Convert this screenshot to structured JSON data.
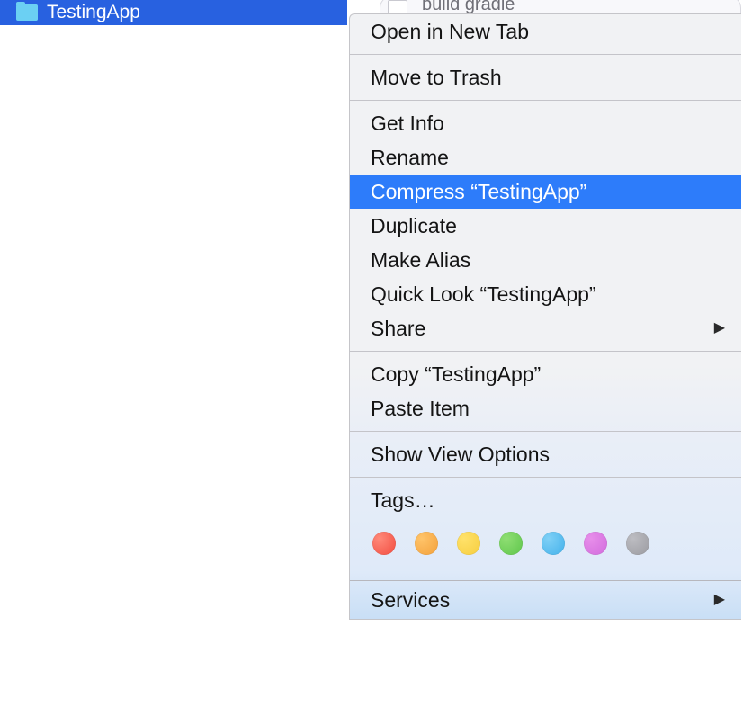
{
  "selected_item": {
    "name": "TestingApp"
  },
  "background_hint_file": "build gradle",
  "menu": {
    "open_in_new_tab": "Open in New Tab",
    "move_to_trash": "Move to Trash",
    "get_info": "Get Info",
    "rename": "Rename",
    "compress": "Compress “TestingApp”",
    "duplicate": "Duplicate",
    "make_alias": "Make Alias",
    "quick_look": "Quick Look “TestingApp”",
    "share": "Share",
    "copy": "Copy “TestingApp”",
    "paste_item": "Paste Item",
    "show_view_options": "Show View Options",
    "tags_label": "Tags…",
    "services": "Services"
  },
  "tag_colors": [
    "red",
    "orange",
    "yellow",
    "green",
    "blue",
    "purple",
    "gray"
  ]
}
